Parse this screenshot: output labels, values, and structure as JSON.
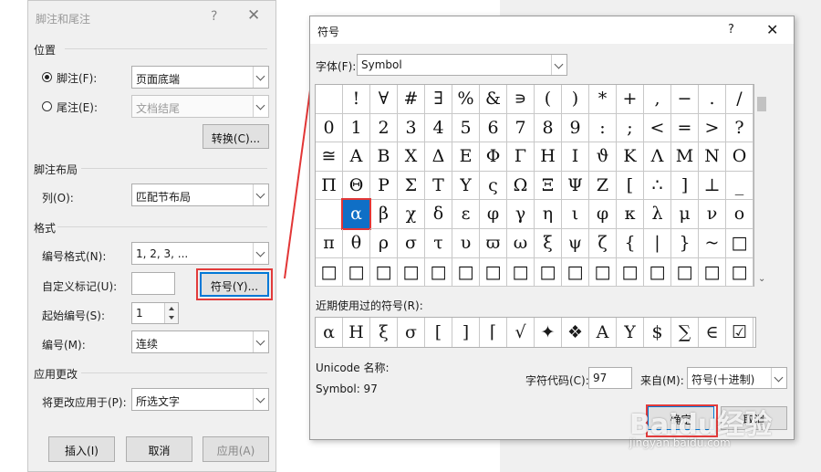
{
  "footnote_dialog": {
    "title": "脚注和尾注",
    "help": "?",
    "close": "✕",
    "location_section": "位置",
    "footnote_label": "脚注(F):",
    "footnote_value": "页面底端",
    "endnote_label": "尾注(E):",
    "endnote_value": "文档结尾",
    "convert_button": "转换(C)...",
    "layout_section": "脚注布局",
    "columns_label": "列(O):",
    "columns_value": "匹配节布局",
    "format_section": "格式",
    "number_format_label": "编号格式(N):",
    "number_format_value": "1, 2, 3, ...",
    "custom_mark_label": "自定义标记(U):",
    "custom_mark_value": "",
    "symbol_button": "符号(Y)...",
    "start_at_label": "起始编号(S):",
    "start_at_value": "1",
    "numbering_label": "编号(M):",
    "numbering_value": "连续",
    "apply_section": "应用更改",
    "apply_to_label": "将更改应用于(P):",
    "apply_to_value": "所选文字",
    "insert_button": "插入(I)",
    "cancel_button": "取消",
    "apply_button": "应用(A)"
  },
  "symbol_dialog": {
    "title": "符号",
    "help": "?",
    "close": "✕",
    "font_label": "字体(F):",
    "font_value": "Symbol",
    "grid_rows": [
      [
        " ",
        "!",
        "∀",
        "#",
        "∃",
        "%",
        "&",
        "∍",
        "(",
        ")",
        "*",
        "+",
        ",",
        "−",
        ".",
        "/"
      ],
      [
        "0",
        "1",
        "2",
        "3",
        "4",
        "5",
        "6",
        "7",
        "8",
        "9",
        ":",
        ";",
        "<",
        "=",
        ">",
        "?"
      ],
      [
        "≅",
        "Α",
        "Β",
        "Χ",
        "Δ",
        "Ε",
        "Φ",
        "Γ",
        "Η",
        "Ι",
        "ϑ",
        "Κ",
        "Λ",
        "Μ",
        "Ν",
        "Ο"
      ],
      [
        "Π",
        "Θ",
        "Ρ",
        "Σ",
        "Τ",
        "Υ",
        "ς",
        "Ω",
        "Ξ",
        "Ψ",
        "Ζ",
        "[",
        "∴",
        "]",
        "⊥",
        "_"
      ],
      [
        " ",
        "α",
        "β",
        "χ",
        "δ",
        "ε",
        "φ",
        "γ",
        "η",
        "ι",
        "φ",
        "κ",
        "λ",
        "μ",
        "ν",
        "ο"
      ],
      [
        "π",
        "θ",
        "ρ",
        "σ",
        "τ",
        "υ",
        "ϖ",
        "ω",
        "ξ",
        "ψ",
        "ζ",
        "{",
        "|",
        "}",
        "~",
        "□"
      ],
      [
        "□",
        "□",
        "□",
        "□",
        "□",
        "□",
        "□",
        "□",
        "□",
        "□",
        "□",
        "□",
        "□",
        "□",
        "□",
        "□"
      ]
    ],
    "selected_symbol": "α",
    "recent_label": "近期使用过的符号(R):",
    "recent_symbols": [
      "α",
      "Η",
      "ξ",
      "σ",
      "[",
      "]",
      "⌈",
      "√",
      "✦",
      "❖",
      "Α",
      "Υ",
      "$",
      "∑",
      "∈",
      "☑"
    ],
    "unicode_name_label": "Unicode 名称:",
    "symbol_info": "Symbol: 97",
    "char_code_label": "字符代码(C):",
    "char_code_value": "97",
    "from_label": "来自(M):",
    "from_value": "符号(十进制)",
    "ok_button": "确定",
    "cancel_button": "取消"
  },
  "watermark": {
    "logo": "Baidu经验",
    "url": "jingyan.baidu.com"
  },
  "colors": {
    "highlight_red": "#e23636",
    "selection_blue": "#0f6fc6"
  }
}
